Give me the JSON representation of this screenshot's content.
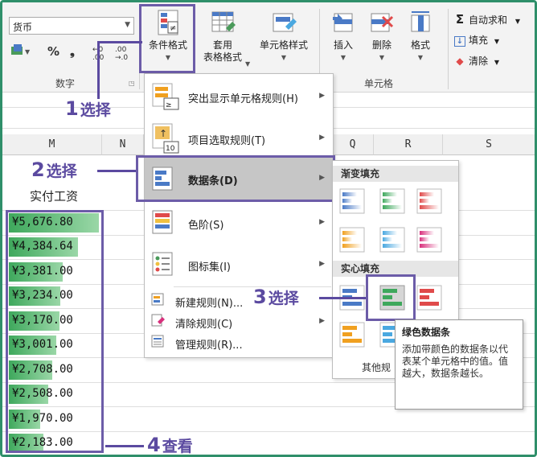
{
  "ribbon": {
    "number_format": "货币",
    "percent_symbol": "%",
    "comma_symbol": "❟",
    "inc_decimal": "←0 .00",
    "dec_decimal": ".00 →.0",
    "group_number": "数字",
    "group_cells": "单元格",
    "conditional_format": "条件格式",
    "table_format_1": "套用",
    "table_format_2": "表格格式",
    "cell_styles": "单元格样式",
    "insert": "插入",
    "delete": "删除",
    "format": "格式",
    "autosum": "自动求和",
    "fill": "填充",
    "clear": "清除"
  },
  "columns": [
    "M",
    "N",
    "Q",
    "R",
    "S"
  ],
  "column_header": "实付工资",
  "salary_rows": [
    {
      "value": "¥5,676.80",
      "bar": 1.0
    },
    {
      "value": "¥4,384.64",
      "bar": 0.77
    },
    {
      "value": "¥3,381.00",
      "bar": 0.6
    },
    {
      "value": "¥3,234.00",
      "bar": 0.57
    },
    {
      "value": "¥3,170.00",
      "bar": 0.56
    },
    {
      "value": "¥3,001.00",
      "bar": 0.53
    },
    {
      "value": "¥2,708.00",
      "bar": 0.48
    },
    {
      "value": "¥2,508.00",
      "bar": 0.44
    },
    {
      "value": "¥1,970.00",
      "bar": 0.35
    },
    {
      "value": "¥2,183.00",
      "bar": 0.38
    }
  ],
  "cf_menu": {
    "highlight_rules": "突出显示单元格规则(H)",
    "top_bottom_rules": "项目选取规则(T)",
    "data_bars": "数据条(D)",
    "color_scales": "色阶(S)",
    "icon_sets": "图标集(I)",
    "new_rule": "新建规则(N)...",
    "clear_rules": "清除规则(C)",
    "manage_rules": "管理规则(R)..."
  },
  "sub_menu": {
    "gradient_fill": "渐变填充",
    "solid_fill": "实心填充",
    "more_rules": "其他规"
  },
  "tooltip": {
    "title": "绿色数据条",
    "body": "添加带颜色的数据条以代表某个单元格中的值。值越大，数据条越长。"
  },
  "callouts": {
    "step1_num": "1",
    "step1": "选择",
    "step2_num": "2",
    "step2": "选择",
    "step3_num": "3",
    "step3": "选择",
    "step4_num": "4",
    "step4": "查看"
  },
  "colors": {
    "accent": "#5b4aa0",
    "frame": "#2f8f6a",
    "bar_green": "#3ea85c",
    "bar_blue": "#4a7ac6",
    "bar_red": "#e04a4a",
    "bar_orange": "#f0a020",
    "bar_pink": "#d8307c",
    "bar_lightblue": "#4aa8e0"
  }
}
